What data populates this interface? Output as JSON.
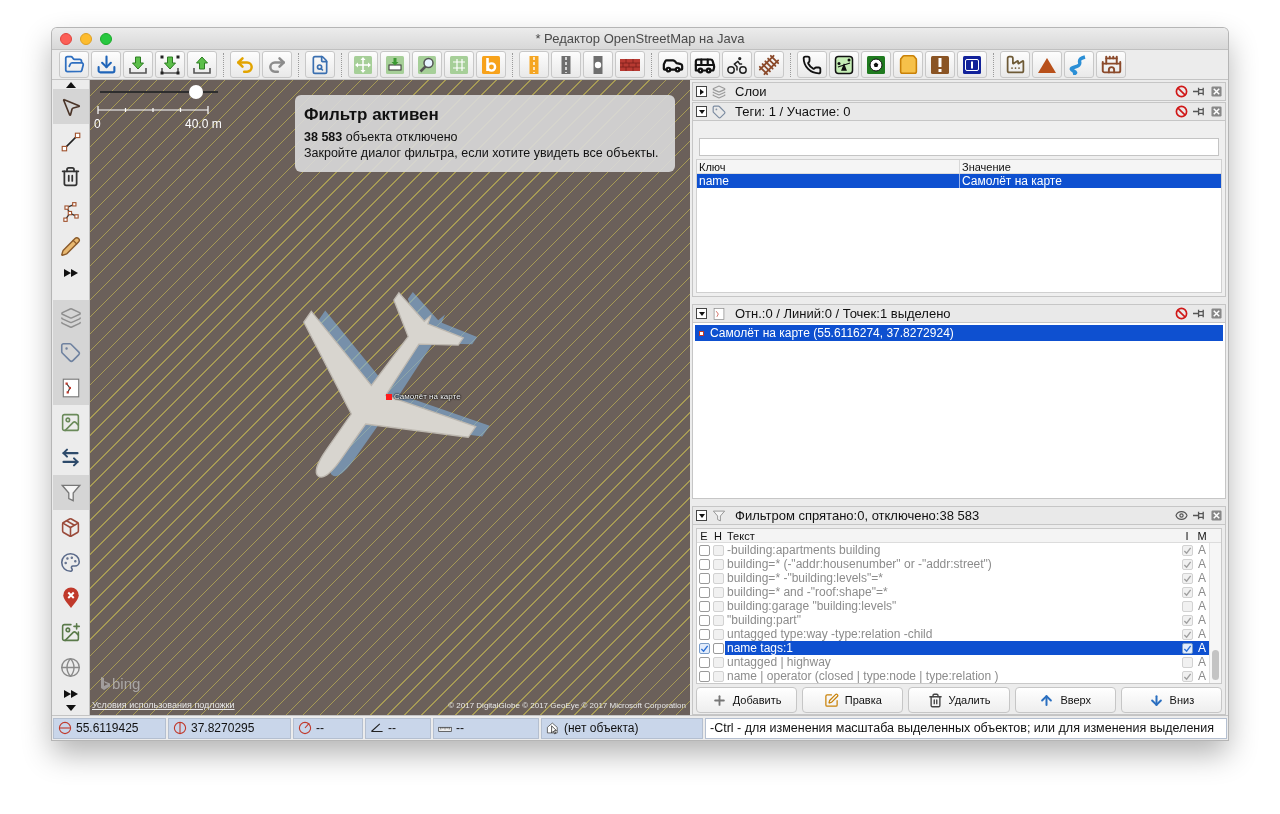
{
  "window": {
    "title": "* Редактор OpenStreetMap на Java"
  },
  "toolbar": {
    "groups": [
      [
        {
          "kind": "open"
        },
        {
          "kind": "open_location"
        },
        {
          "kind": "download"
        },
        {
          "kind": "download_area"
        },
        {
          "kind": "upload"
        }
      ],
      [
        {
          "kind": "undo"
        },
        {
          "kind": "redo"
        }
      ],
      [
        {
          "kind": "zoom"
        }
      ],
      [
        {
          "kind": "imagery_move"
        },
        {
          "kind": "imagery_download"
        },
        {
          "kind": "imagery_search"
        },
        {
          "kind": "wms"
        },
        {
          "kind": "bing"
        }
      ],
      [
        {
          "kind": "road_primary"
        },
        {
          "kind": "road_secondary"
        },
        {
          "kind": "road_junction"
        },
        {
          "kind": "wall"
        }
      ],
      [
        {
          "kind": "car"
        },
        {
          "kind": "bus"
        },
        {
          "kind": "bike"
        },
        {
          "kind": "railway"
        }
      ],
      [
        {
          "kind": "phone"
        },
        {
          "kind": "playground"
        },
        {
          "kind": "sport"
        },
        {
          "kind": "shop"
        },
        {
          "kind": "warning"
        },
        {
          "kind": "info"
        }
      ],
      [
        {
          "kind": "factory"
        },
        {
          "kind": "peak"
        },
        {
          "kind": "river"
        },
        {
          "kind": "castle"
        }
      ]
    ]
  },
  "left_toolbar": {
    "modes": [
      {
        "kind": "select",
        "selected": true
      },
      {
        "kind": "draw",
        "selected": false
      },
      {
        "kind": "delete",
        "selected": false
      },
      {
        "kind": "improve",
        "selected": false
      },
      {
        "kind": "pencil",
        "selected": false
      }
    ],
    "dialogs": [
      {
        "kind": "layers",
        "selected": true
      },
      {
        "kind": "tags",
        "selected": true
      },
      {
        "kind": "selection",
        "selected": true
      },
      {
        "kind": "imagery",
        "selected": false
      },
      {
        "kind": "conflict",
        "selected": false
      },
      {
        "kind": "filter",
        "selected": true
      },
      {
        "kind": "package",
        "selected": false
      },
      {
        "kind": "style",
        "selected": false
      },
      {
        "kind": "notes",
        "selected": false
      },
      {
        "kind": "edit_image",
        "selected": false
      },
      {
        "kind": "globe",
        "selected": false
      }
    ]
  },
  "map": {
    "zoom_slider": {
      "level": 0.81
    },
    "scale": {
      "start": "0",
      "end": "40.0 m"
    },
    "filter_notice": {
      "title": "Фильтр активен",
      "count_line": "**38 583** объекта отключено",
      "hint": "Закройте диалог фильтра, если хотите увидеть все объекты."
    },
    "node": {
      "label": "Самолёт на карте"
    },
    "logo": "bing",
    "terms_link": "Условия использования подложки",
    "attribution": "© 2017 DigitalGlobe © 2017 GeoEye © 2017 Microsoft Corporation"
  },
  "panels": [
    {
      "kind": "layers",
      "title": "Слои",
      "expanded": false
    },
    {
      "kind": "tags",
      "title": "Теги: 1 / Участие: 0",
      "expanded": true,
      "columns": [
        "Ключ",
        "Значение"
      ],
      "rows": [
        {
          "cells": [
            "name",
            "Самолёт на карте"
          ],
          "selected": true
        }
      ]
    },
    {
      "kind": "selection",
      "title": "Отн.:0 / Линий:0 / Точек:1 выделено",
      "expanded": true,
      "items": [
        {
          "label": "Самолёт на карте (55.6116274, 37.8272924)",
          "selected": true
        }
      ]
    },
    {
      "kind": "filter",
      "title": "Фильтром спрятано:0, отключено:38 583",
      "expanded": true,
      "columns": [
        "E",
        "H",
        "Текст",
        "I",
        "M"
      ],
      "rows": [
        {
          "enabled": false,
          "hiding": false,
          "text": "-building:apartments building",
          "inverted": true,
          "mode": "A",
          "selected": false
        },
        {
          "enabled": false,
          "hiding": false,
          "text": "building=* (-\"addr:housenumber\" or -\"addr:street\")",
          "inverted": true,
          "mode": "A",
          "selected": false
        },
        {
          "enabled": false,
          "hiding": false,
          "text": "building=* -\"building:levels\"=*",
          "inverted": true,
          "mode": "A",
          "selected": false
        },
        {
          "enabled": false,
          "hiding": false,
          "text": "building=* and -\"roof:shape\"=*",
          "inverted": true,
          "mode": "A",
          "selected": false
        },
        {
          "enabled": false,
          "hiding": false,
          "text": "building:garage \"building:levels\"",
          "inverted": false,
          "mode": "A",
          "selected": false
        },
        {
          "enabled": false,
          "hiding": false,
          "text": "\"building:part\"",
          "inverted": true,
          "mode": "A",
          "selected": false
        },
        {
          "enabled": false,
          "hiding": false,
          "text": "untagged type:way -type:relation -child",
          "inverted": true,
          "mode": "A",
          "selected": false
        },
        {
          "enabled": true,
          "hiding": false,
          "text": "name tags:1",
          "inverted": true,
          "mode": "A",
          "selected": true
        },
        {
          "enabled": false,
          "hiding": false,
          "text": "untagged | highway",
          "inverted": false,
          "mode": "A",
          "selected": false
        },
        {
          "enabled": false,
          "hiding": false,
          "text": "name | operator (closed | type:node | type:relation )",
          "inverted": true,
          "mode": "A",
          "selected": false
        }
      ],
      "buttons": [
        {
          "kind": "add",
          "label": "Добавить"
        },
        {
          "kind": "edit",
          "label": "Правка"
        },
        {
          "kind": "delete",
          "label": "Удалить"
        },
        {
          "kind": "up",
          "label": "Вверх"
        },
        {
          "kind": "down",
          "label": "Вниз"
        }
      ]
    }
  ],
  "status_bar": [
    {
      "kind": "lat",
      "value": "55.6119425"
    },
    {
      "kind": "lon",
      "value": "37.8270295"
    },
    {
      "kind": "heading",
      "value": "--"
    },
    {
      "kind": "angle",
      "value": "--"
    },
    {
      "kind": "distance",
      "value": "--"
    },
    {
      "kind": "name",
      "value": "(нет объекта)"
    },
    {
      "kind": "help",
      "value": "-Ctrl - для изменения масштаба выделенных объектов; или для изменения выделения"
    }
  ]
}
